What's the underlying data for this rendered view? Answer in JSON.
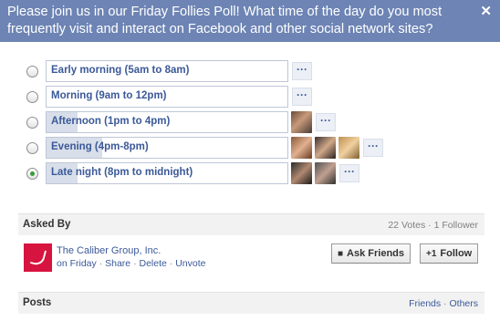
{
  "header": {
    "question": "Please join us in our Friday Follies Poll! What time of the day do you most frequently visit and interact on Facebook and other social network sites?",
    "close_label": "✕"
  },
  "options": [
    {
      "label": "Early morning (5am to 8am)",
      "selected": false,
      "voters": [],
      "more_label": "···"
    },
    {
      "label": "Morning (9am to 12pm)",
      "selected": false,
      "voters": [],
      "more_label": "···"
    },
    {
      "label": "Afternoon (1pm to 4pm)",
      "selected": false,
      "voters": [
        "voter-a"
      ],
      "more_label": "···"
    },
    {
      "label": "Evening (4pm-8pm)",
      "selected": false,
      "voters": [
        "voter-b",
        "voter-c",
        "voter-d"
      ],
      "more_label": "···"
    },
    {
      "label": "Late night (8pm to midnight)",
      "selected": true,
      "voters": [
        "voter-e",
        "voter-f"
      ],
      "more_label": "···"
    }
  ],
  "asked_by": {
    "title": "Asked By",
    "votes": "22 Votes",
    "dot": " · ",
    "followers": "1 Follower",
    "name": "The Caliber Group, Inc.",
    "day": "on Friday",
    "share": "Share",
    "delete": "Delete",
    "unvote": "Unvote",
    "ask_friends_label": "Ask Friends",
    "follow_label": "Follow",
    "follow_icon": "+1"
  },
  "posts": {
    "title": "Posts",
    "friends": "Friends",
    "others": "Others"
  },
  "colors": {
    "header_bg": "#6d84b4",
    "accent": "#3b5998",
    "selected_radio": "#3b9a3b",
    "avatar_brand": "#d7143f"
  }
}
